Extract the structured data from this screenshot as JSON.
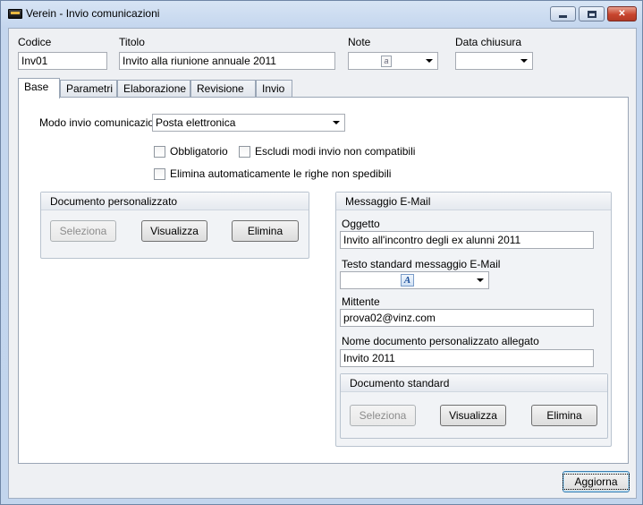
{
  "window": {
    "title": "Verein - Invio comunicazioni"
  },
  "header": {
    "codice_label": "Codice",
    "codice_value": "Inv01",
    "titolo_label": "Titolo",
    "titolo_value": "Invito alla riunione annuale 2011",
    "note_label": "Note",
    "note_icon_text": "a",
    "data_chiusura_label": "Data chiusura",
    "data_chiusura_value": ""
  },
  "tabs": [
    {
      "label": "Base",
      "active": true
    },
    {
      "label": "Parametri"
    },
    {
      "label": "Elaborazione"
    },
    {
      "label": "Revisione"
    },
    {
      "label": "Invio"
    }
  ],
  "base": {
    "modo_invio_label": "Modo invio comunicazioni",
    "modo_invio_value": "Posta elettronica",
    "obbligatorio_label": "Obbligatorio",
    "escludi_label": "Escludi modi invio non compatibili",
    "elimina_righe_label": "Elimina automaticamente le righe non spedibili",
    "documento_personalizzato": {
      "title": "Documento personalizzato",
      "seleziona": "Seleziona",
      "visualizza": "Visualizza",
      "elimina": "Elimina"
    },
    "messaggio_email": {
      "title": "Messaggio E-Mail",
      "oggetto_label": "Oggetto",
      "oggetto_value": "Invito all'incontro degli ex alunni 2011",
      "testo_standard_label": "Testo standard messaggio E-Mail",
      "testo_icon_text": "A",
      "mittente_label": "Mittente",
      "mittente_value": "prova02@vinz.com",
      "nome_documento_label": "Nome documento  personalizzato allegato",
      "nome_documento_value": "Invito 2011",
      "documento_standard": {
        "title": "Documento standard",
        "seleziona": "Seleziona",
        "visualizza": "Visualizza",
        "elimina": "Elimina"
      }
    }
  },
  "footer": {
    "aggiorna": "Aggiorna"
  }
}
